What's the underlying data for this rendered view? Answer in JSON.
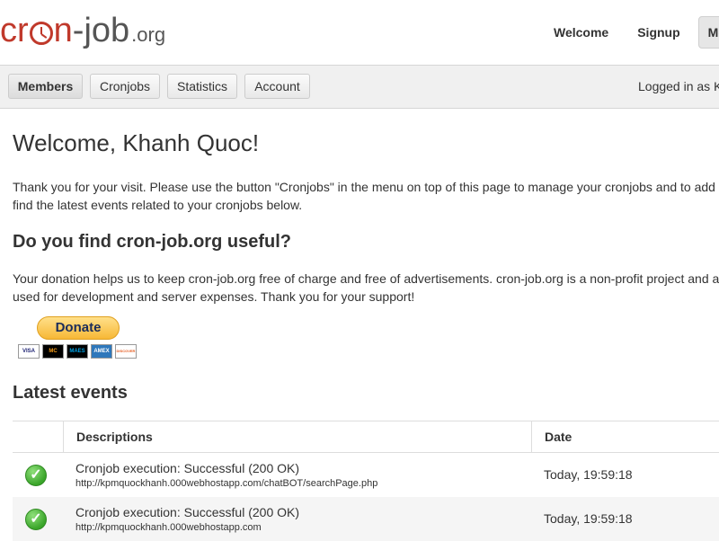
{
  "logo": {
    "part_cr": "cr",
    "part_n": "n",
    "part_dash_job": "-job",
    "part_org": ".org"
  },
  "topnav": {
    "items": [
      {
        "label": "Welcome"
      },
      {
        "label": "Signup"
      },
      {
        "label": "Me"
      }
    ]
  },
  "subnav": {
    "buttons": [
      {
        "label": "Members"
      },
      {
        "label": "Cronjobs"
      },
      {
        "label": "Statistics"
      },
      {
        "label": "Account"
      }
    ],
    "logged_in": "Logged in as K"
  },
  "main": {
    "title": "Welcome, Khanh Quoc!",
    "intro_line1": "Thank you for your visit. Please use the button \"Cronjobs\" in the menu on top of this page to manage your cronjobs and to add",
    "intro_line2": "find the latest events related to your cronjobs below.",
    "useful_heading": "Do you find cron-job.org useful?",
    "donation_line1": "Your donation helps us to keep cron-job.org free of charge and free of advertisements. cron-job.org is a non-profit project and a",
    "donation_line2": "used for development and server expenses. Thank you for your support!",
    "donate_label": "Donate",
    "cards": [
      "VISA",
      "MC",
      "MAES",
      "AMEX",
      "DISCOVER"
    ],
    "events_heading": "Latest events"
  },
  "events_table": {
    "headers": {
      "descriptions": "Descriptions",
      "date": "Date"
    },
    "rows": [
      {
        "description": "Cronjob execution: Successful (200 OK)",
        "url": "http://kpmquockhanh.000webhostapp.com/chatBOT/searchPage.php",
        "date": "Today, 19:59:18"
      },
      {
        "description": "Cronjob execution: Successful (200 OK)",
        "url": "http://kpmquockhanh.000webhostapp.com",
        "date": "Today, 19:59:18"
      }
    ]
  },
  "colors": {
    "brand_red": "#c0392b",
    "success_green": "#3aa52a",
    "donate_gold": "#f7b836"
  }
}
